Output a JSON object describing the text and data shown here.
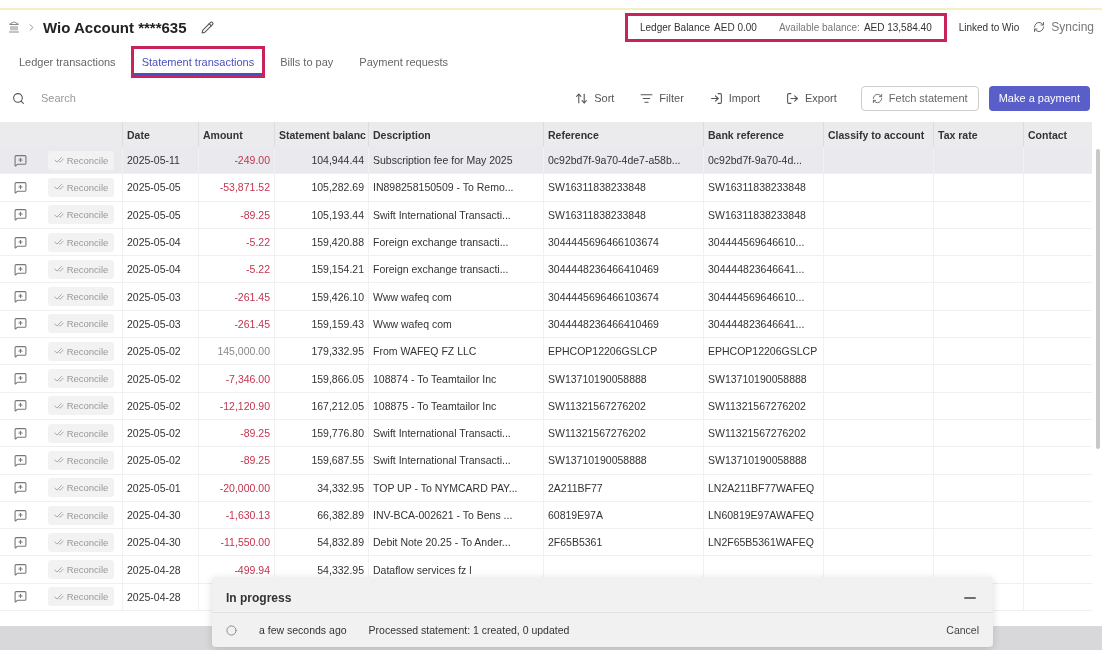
{
  "breadcrumb": {
    "title": "Wio Account ****635"
  },
  "balances": {
    "highlighted": true,
    "ledger_label": "Ledger Balance",
    "ledger_value": "AED 0.00",
    "available_label": "Available balance:",
    "available_value": "AED 13,584.40"
  },
  "link_status": "Linked to Wio",
  "sync_status": "Syncing",
  "tabs": [
    {
      "label": "Ledger transactions",
      "selected": false,
      "highlighted": false
    },
    {
      "label": "Statement transactions",
      "selected": true,
      "highlighted": true
    },
    {
      "label": "Bills to pay",
      "selected": false,
      "highlighted": false
    },
    {
      "label": "Payment requests",
      "selected": false,
      "highlighted": false
    }
  ],
  "search": {
    "placeholder": "Search"
  },
  "toolbar": [
    {
      "kind": "sort",
      "label": "Sort"
    },
    {
      "kind": "filter",
      "label": "Filter"
    },
    {
      "kind": "import",
      "label": "Import"
    },
    {
      "kind": "export",
      "label": "Export"
    },
    {
      "kind": "fetch",
      "label": "Fetch statement"
    },
    {
      "kind": "primary",
      "label": "Make a payment"
    }
  ],
  "table": {
    "columns": [
      "Date",
      "Amount",
      "Statement balanc",
      "Description",
      "Reference",
      "Bank reference",
      "Classify to account",
      "Tax rate",
      "Contact"
    ],
    "rows": [
      {
        "selected": true,
        "action": "Reconcile",
        "date": "2025-05-11",
        "kind": "debit",
        "amount": "-249.00",
        "balance": "104,944.44",
        "description": "Subscription fee for May 2025",
        "reference": "0c92bd7f-9a70-4de7-a58b...",
        "bank_reference": "0c92bd7f-9a70-4d..."
      },
      {
        "selected": false,
        "action": "Reconcile",
        "date": "2025-05-05",
        "kind": "debit",
        "amount": "-53,871.52",
        "balance": "105,282.69",
        "description": "IN898258150509 - To Remo...",
        "reference": "SW16311838233848",
        "bank_reference": "SW16311838233848"
      },
      {
        "selected": false,
        "action": "Reconcile",
        "date": "2025-05-05",
        "kind": "debit",
        "amount": "-89.25",
        "balance": "105,193.44",
        "description": "Swift International Transacti...",
        "reference": "SW16311838233848",
        "bank_reference": "SW16311838233848"
      },
      {
        "selected": false,
        "action": "Reconcile",
        "date": "2025-05-04",
        "kind": "debit",
        "amount": "-5.22",
        "balance": "159,420.88",
        "description": "Foreign exchange transacti...",
        "reference": "3044445696466103674",
        "bank_reference": "304444569646610..."
      },
      {
        "selected": false,
        "action": "Reconcile",
        "date": "2025-05-04",
        "kind": "debit",
        "amount": "-5.22",
        "balance": "159,154.21",
        "description": "Foreign exchange transacti...",
        "reference": "3044448236466410469",
        "bank_reference": "304444823646641..."
      },
      {
        "selected": false,
        "action": "Reconcile",
        "date": "2025-05-03",
        "kind": "debit",
        "amount": "-261.45",
        "balance": "159,426.10",
        "description": "Www wafeq com",
        "reference": "3044445696466103674",
        "bank_reference": "304444569646610..."
      },
      {
        "selected": false,
        "action": "Reconcile",
        "date": "2025-05-03",
        "kind": "debit",
        "amount": "-261.45",
        "balance": "159,159.43",
        "description": "Www wafeq com",
        "reference": "3044448236466410469",
        "bank_reference": "304444823646641..."
      },
      {
        "selected": false,
        "action": "Reconcile",
        "date": "2025-05-02",
        "kind": "credit",
        "amount": "145,000.00",
        "balance": "179,332.95",
        "description": "From WAFEQ FZ LLC",
        "reference": "EPHCOP12206GSLCP",
        "bank_reference": "EPHCOP12206GSLCP"
      },
      {
        "selected": false,
        "action": "Reconcile",
        "date": "2025-05-02",
        "kind": "debit",
        "amount": "-7,346.00",
        "balance": "159,866.05",
        "description": "108874 - To Teamtailor Inc",
        "reference": "SW13710190058888",
        "bank_reference": "SW13710190058888"
      },
      {
        "selected": false,
        "action": "Reconcile",
        "date": "2025-05-02",
        "kind": "debit",
        "amount": "-12,120.90",
        "balance": "167,212.05",
        "description": "108875 - To Teamtailor Inc",
        "reference": "SW11321567276202",
        "bank_reference": "SW11321567276202"
      },
      {
        "selected": false,
        "action": "Reconcile",
        "date": "2025-05-02",
        "kind": "debit",
        "amount": "-89.25",
        "balance": "159,776.80",
        "description": "Swift International Transacti...",
        "reference": "SW11321567276202",
        "bank_reference": "SW11321567276202"
      },
      {
        "selected": false,
        "action": "Reconcile",
        "date": "2025-05-02",
        "kind": "debit",
        "amount": "-89.25",
        "balance": "159,687.55",
        "description": "Swift International Transacti...",
        "reference": "SW13710190058888",
        "bank_reference": "SW13710190058888"
      },
      {
        "selected": false,
        "action": "Reconcile",
        "date": "2025-05-01",
        "kind": "debit",
        "amount": "-20,000.00",
        "balance": "34,332.95",
        "description": "TOP UP - To NYMCARD PAY...",
        "reference": "2A211BF77",
        "bank_reference": "LN2A211BF77WAFEQ"
      },
      {
        "selected": false,
        "action": "Reconcile",
        "date": "2025-04-30",
        "kind": "debit",
        "amount": "-1,630.13",
        "balance": "66,382.89",
        "description": "INV-BCA-002621 - To Bens ...",
        "reference": "60819E97A",
        "bank_reference": "LN60819E97AWAFEQ"
      },
      {
        "selected": false,
        "action": "Reconcile",
        "date": "2025-04-30",
        "kind": "debit",
        "amount": "-11,550.00",
        "balance": "54,832.89",
        "description": "Debit Note 20.25 - To Ander...",
        "reference": "2F65B5361",
        "bank_reference": "LN2F65B5361WAFEQ"
      },
      {
        "selected": false,
        "action": "Reconcile",
        "date": "2025-04-28",
        "kind": "debit",
        "amount": "-499.94",
        "balance": "54,332.95",
        "description": "Dataflow services fz l"
      },
      {
        "selected": false,
        "action": "Reconcile",
        "date": "2025-04-28"
      }
    ]
  },
  "progress_panel": {
    "title": "In progress",
    "time": "a few seconds ago",
    "message": "Processed statement: 1 created, 0 updated",
    "cancel": "Cancel"
  }
}
